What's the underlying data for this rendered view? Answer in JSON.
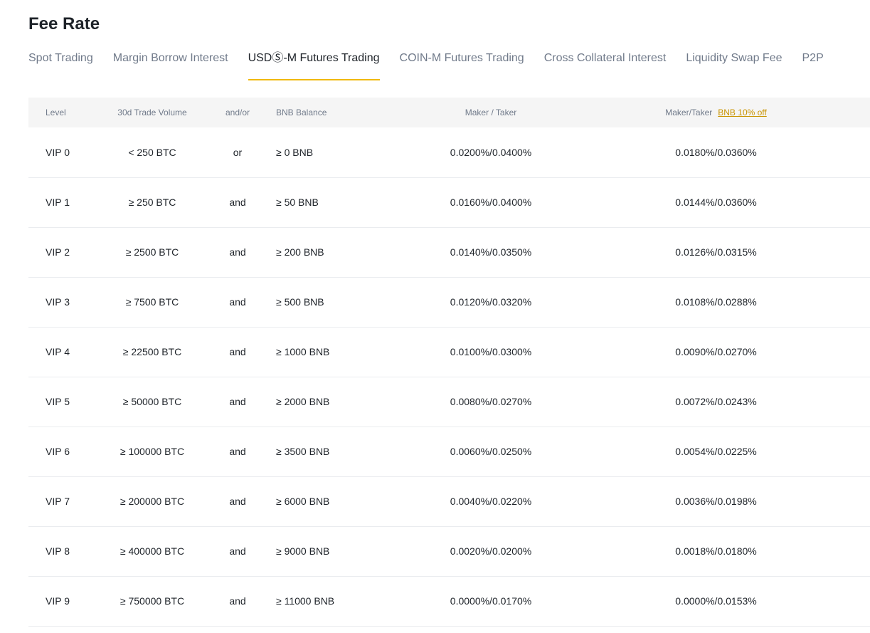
{
  "page": {
    "title": "Fee Rate"
  },
  "tabs": [
    {
      "label": "Spot Trading",
      "active": false
    },
    {
      "label": "Margin Borrow Interest",
      "active": false
    },
    {
      "label": "USDⓈ-M Futures Trading",
      "active": true
    },
    {
      "label": "COIN-M Futures Trading",
      "active": false
    },
    {
      "label": "Cross Collateral Interest",
      "active": false
    },
    {
      "label": "Liquidity Swap Fee",
      "active": false
    },
    {
      "label": "P2P",
      "active": false
    }
  ],
  "colors": {
    "accent": "#f0b90b",
    "link": "#c99400",
    "header_bg": "#f5f5f5"
  },
  "table": {
    "headers": {
      "level": "Level",
      "volume": "30d Trade Volume",
      "andor": "and/or",
      "bnb": "BNB Balance",
      "maker_taker": "Maker / Taker",
      "maker_taker_discount": "Maker/Taker",
      "discount_link": "BNB 10% off"
    },
    "rows": [
      {
        "level": "VIP 0",
        "volume": "< 250 BTC",
        "andor": "or",
        "bnb": "≥ 0 BNB",
        "maker_taker": "0.0200%/0.0400%",
        "discount": "0.0180%/0.0360%"
      },
      {
        "level": "VIP 1",
        "volume": "≥ 250 BTC",
        "andor": "and",
        "bnb": "≥ 50 BNB",
        "maker_taker": "0.0160%/0.0400%",
        "discount": "0.0144%/0.0360%"
      },
      {
        "level": "VIP 2",
        "volume": "≥ 2500 BTC",
        "andor": "and",
        "bnb": "≥ 200 BNB",
        "maker_taker": "0.0140%/0.0350%",
        "discount": "0.0126%/0.0315%"
      },
      {
        "level": "VIP 3",
        "volume": "≥ 7500 BTC",
        "andor": "and",
        "bnb": "≥ 500 BNB",
        "maker_taker": "0.0120%/0.0320%",
        "discount": "0.0108%/0.0288%"
      },
      {
        "level": "VIP 4",
        "volume": "≥ 22500 BTC",
        "andor": "and",
        "bnb": "≥ 1000 BNB",
        "maker_taker": "0.0100%/0.0300%",
        "discount": "0.0090%/0.0270%"
      },
      {
        "level": "VIP 5",
        "volume": "≥ 50000 BTC",
        "andor": "and",
        "bnb": "≥ 2000 BNB",
        "maker_taker": "0.0080%/0.0270%",
        "discount": "0.0072%/0.0243%"
      },
      {
        "level": "VIP 6",
        "volume": "≥ 100000 BTC",
        "andor": "and",
        "bnb": "≥ 3500 BNB",
        "maker_taker": "0.0060%/0.0250%",
        "discount": "0.0054%/0.0225%"
      },
      {
        "level": "VIP 7",
        "volume": "≥ 200000 BTC",
        "andor": "and",
        "bnb": "≥ 6000 BNB",
        "maker_taker": "0.0040%/0.0220%",
        "discount": "0.0036%/0.0198%"
      },
      {
        "level": "VIP 8",
        "volume": "≥ 400000 BTC",
        "andor": "and",
        "bnb": "≥ 9000 BNB",
        "maker_taker": "0.0020%/0.0200%",
        "discount": "0.0018%/0.0180%"
      },
      {
        "level": "VIP 9",
        "volume": "≥ 750000 BTC",
        "andor": "and",
        "bnb": "≥ 11000 BNB",
        "maker_taker": "0.0000%/0.0170%",
        "discount": "0.0000%/0.0153%"
      }
    ]
  }
}
